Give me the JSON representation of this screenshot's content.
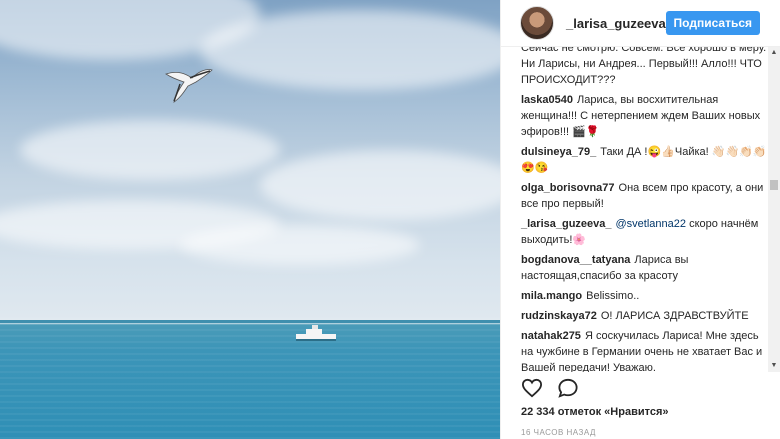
{
  "header": {
    "username": "_larisa_guzeeva_",
    "follow_label": "Подписаться"
  },
  "comments": [
    {
      "author": "",
      "text": "Сейчас не смотрю. Совсем. Всё хорошо в меру. Ни Ларисы, ни Андрея... Первый!!! Алло!!! ЧТО ПРОИСХОДИТ???"
    },
    {
      "author": "laska0540",
      "text": "Лариса, вы восхитительная женщина!!! С нетерпением ждем Ваших новых эфиров!!! 🎬🌹"
    },
    {
      "author": "dulsineya_79_",
      "text": "Таки ДА !😜👍🏻Чайка! 👋🏻👋🏻👏🏻👏🏻😍😘"
    },
    {
      "author": "olga_borisovna77",
      "text": "Она всем про красоту, а они все про первый!"
    },
    {
      "author": "_larisa_guzeeva_",
      "mention": "@svetlanna22",
      "text": "скоро начнём выходить!🌸"
    },
    {
      "author": "bogdanova__tatyana",
      "text": "Лариса вы настоящая,спасибо за красоту"
    },
    {
      "author": "mila.mango",
      "text": "Belissimo.."
    },
    {
      "author": "rudzinskaya72",
      "text": "О! ЛАРИСА ЗДРАВСТВУЙТЕ"
    },
    {
      "author": "natahak275",
      "text": "Я соскучилась Лариса! Мне здесь на чужбине в Германии очень не хватает Вас и Вашей передачи! Уважаю."
    }
  ],
  "actions": {
    "like_icon": "heart-icon",
    "comment_icon": "comment-icon"
  },
  "likes": "22 334 отметок «Нравится»",
  "time": "16 ЧАСОВ НАЗАД",
  "colors": {
    "accent": "#3897f0",
    "text": "#262626",
    "muted": "#999999"
  }
}
